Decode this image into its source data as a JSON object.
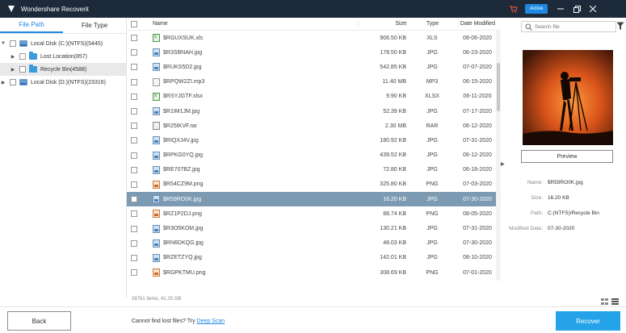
{
  "app": {
    "title": "Wondershare Recoverit",
    "status": "Active"
  },
  "tabs": [
    {
      "label": "File Path"
    },
    {
      "label": "File Type"
    }
  ],
  "tree": [
    {
      "label": "Local Disk (C:)(NTFS)(5445)"
    },
    {
      "label": "Lost Location(857)"
    },
    {
      "label": "Recycle Bin(4588)"
    },
    {
      "label": "Local Disk (D:)(NTFS)(23316)"
    }
  ],
  "columns": {
    "name": "Name",
    "size": "Size",
    "type": "Type",
    "date": "Date Modified"
  },
  "files": [
    {
      "name": "$RGUXSUK.xls",
      "size": "906.50 KB",
      "type": "XLS",
      "date": "08-06-2020",
      "icon": "xls"
    },
    {
      "name": "$R3SBNAH.jpg",
      "size": "178.50 KB",
      "type": "JPG",
      "date": "06-23-2020",
      "icon": "jpg"
    },
    {
      "name": "$RUKS5D2.jpg",
      "size": "542.85 KB",
      "type": "JPG",
      "date": "07-07-2020",
      "icon": "jpg"
    },
    {
      "name": "$RPQW2ZI.mp3",
      "size": "11.40 MB",
      "type": "MP3",
      "date": "06-15-2020",
      "icon": "mp3"
    },
    {
      "name": "$RSYJGTF.xlsx",
      "size": "9.90 KB",
      "type": "XLSX",
      "date": "06-11-2020",
      "icon": "xls"
    },
    {
      "name": "$R1IM1JM.jpg",
      "size": "52.39 KB",
      "type": "JPG",
      "date": "07-17-2020",
      "icon": "jpg"
    },
    {
      "name": "$R25IKVF.rar",
      "size": "2.30 MB",
      "type": "RAR",
      "date": "06-12-2020",
      "icon": "rar"
    },
    {
      "name": "$RIQXJ4V.jpg",
      "size": "180.92 KB",
      "type": "JPG",
      "date": "07-31-2020",
      "icon": "jpg"
    },
    {
      "name": "$RPKG0YQ.jpg",
      "size": "439.52 KB",
      "type": "JPG",
      "date": "06-12-2020",
      "icon": "jpg"
    },
    {
      "name": "$RE707BZ.jpg",
      "size": "72.80 KB",
      "type": "JPG",
      "date": "06-18-2020",
      "icon": "jpg"
    },
    {
      "name": "$R54CZ9M.png",
      "size": "325.80 KB",
      "type": "PNG",
      "date": "07-03-2020",
      "icon": "png"
    },
    {
      "name": "$R59RO0K.jpg",
      "size": "16.20 KB",
      "type": "JPG",
      "date": "07-30-2020",
      "icon": "jpg",
      "selected": true
    },
    {
      "name": "$RZ1P2DJ.png",
      "size": "88.74 KB",
      "type": "PNG",
      "date": "08-05-2020",
      "icon": "png"
    },
    {
      "name": "$R3O5KOM.jpg",
      "size": "130.21 KB",
      "type": "JPG",
      "date": "07-31-2020",
      "icon": "jpg"
    },
    {
      "name": "$RN6DKQG.jpg",
      "size": "48.03 KB",
      "type": "JPG",
      "date": "07-30-2020",
      "icon": "jpg"
    },
    {
      "name": "$RZETZYQ.jpg",
      "size": "142.01 KB",
      "type": "JPG",
      "date": "08-10-2020",
      "icon": "jpg"
    },
    {
      "name": "$RGPKTMU.png",
      "size": "308.69 KB",
      "type": "PNG",
      "date": "07-01-2020",
      "icon": "png"
    }
  ],
  "list_footer": "28761 items, 41.25 GB",
  "search": {
    "placeholder": "Search file"
  },
  "preview": {
    "button": "Preview",
    "meta": [
      {
        "label": "Name:",
        "value": "$R59RO0K.jpg"
      },
      {
        "label": "Size:",
        "value": "16.20 KB"
      },
      {
        "label": "Path:",
        "value": "C:(NTFS)/Recycle Bin"
      },
      {
        "label": "Modified Date:",
        "value": "07-30-2020"
      }
    ]
  },
  "bottom": {
    "back": "Back",
    "hint": "Cannot find lost files? Try ",
    "deep_scan": "Deep Scan",
    "recover": "Recover"
  },
  "colors": {
    "titlebar": "#1d2a3a",
    "accent": "#1e88e5",
    "recover": "#24a3e8",
    "selected_row": "#7c9bb3"
  }
}
